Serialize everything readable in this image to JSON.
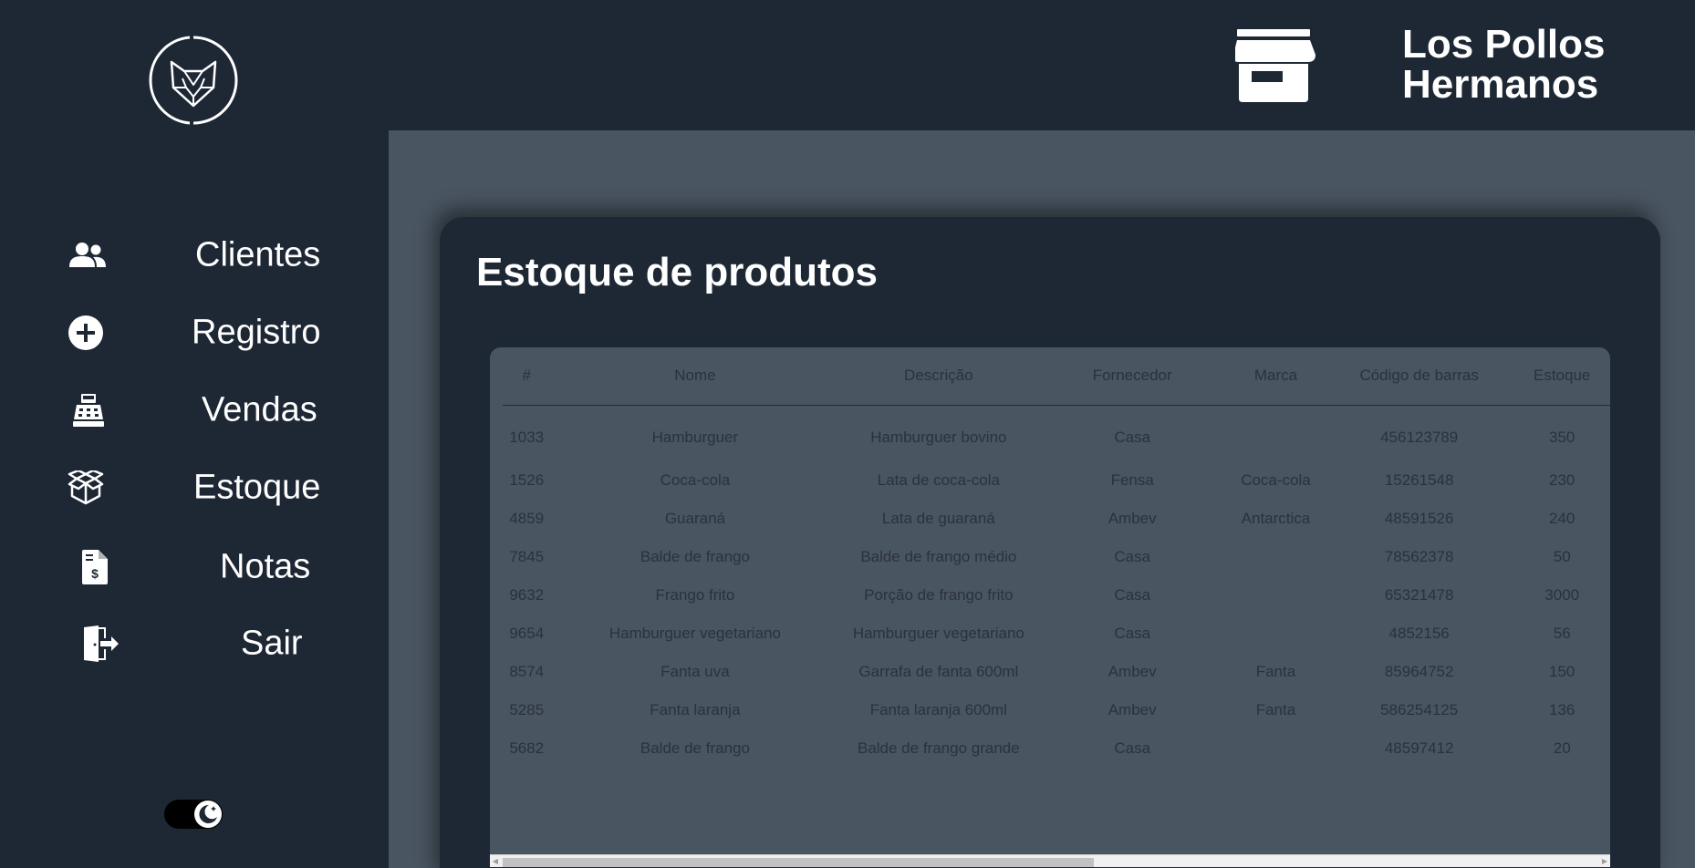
{
  "brand": {
    "line1": "Los Pollos",
    "line2": "Hermanos"
  },
  "sidebar": {
    "items": [
      {
        "label": "Clientes",
        "icon": "users-icon"
      },
      {
        "label": "Registro",
        "icon": "plus-circle-icon"
      },
      {
        "label": "Vendas",
        "icon": "cash-register-icon"
      },
      {
        "label": "Estoque",
        "icon": "boxes-icon"
      },
      {
        "label": "Notas",
        "icon": "invoice-icon"
      },
      {
        "label": "Sair",
        "icon": "logout-icon"
      }
    ],
    "theme_toggle": {
      "icon": "moon-icon",
      "state": "dark"
    }
  },
  "page": {
    "title": "Estoque de produtos",
    "table": {
      "headers": [
        "#",
        "Nome",
        "Descrição",
        "Fornecedor",
        "Marca",
        "Código de barras",
        "Estoque"
      ],
      "rows": [
        [
          "1033",
          "Hamburguer",
          "Hamburguer bovino",
          "Casa",
          "",
          "456123789",
          "350"
        ],
        [
          "1526",
          "Coca-cola",
          "Lata de coca-cola",
          "Fensa",
          "Coca-cola",
          "15261548",
          "230"
        ],
        [
          "4859",
          "Guaraná",
          "Lata de guaraná",
          "Ambev",
          "Antarctica",
          "48591526",
          "240"
        ],
        [
          "7845",
          "Balde de frango",
          "Balde de frango médio",
          "Casa",
          "",
          "78562378",
          "50"
        ],
        [
          "9632",
          "Frango frito",
          "Porção de frango frito",
          "Casa",
          "",
          "65321478",
          "3000"
        ],
        [
          "9654",
          "Hamburguer vegetariano",
          "Hamburguer vegetariano",
          "Casa",
          "",
          "4852156",
          "56"
        ],
        [
          "8574",
          "Fanta uva",
          "Garrafa de fanta 600ml",
          "Ambev",
          "Fanta",
          "85964752",
          "150"
        ],
        [
          "5285",
          "Fanta laranja",
          "Fanta laranja 600ml",
          "Ambev",
          "Fanta",
          "586254125",
          "136"
        ],
        [
          "5682",
          "Balde de frango",
          "Balde de frango grande",
          "Casa",
          "",
          "48597412",
          "20"
        ]
      ]
    },
    "scrollbar": {
      "position": 0,
      "visible_fraction": 0.54
    }
  },
  "colors": {
    "dark": "#1e2835",
    "content": "#4a5562",
    "text_dark": "#2a323d"
  }
}
